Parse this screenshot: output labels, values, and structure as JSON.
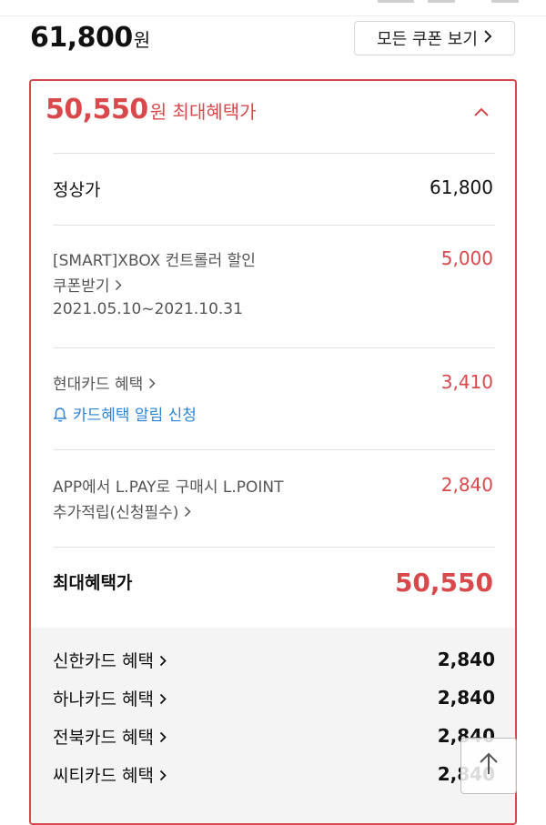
{
  "product": {
    "price": "61,800",
    "price_unit": "원",
    "all_coupons_label": "모든 쿠폰 보기"
  },
  "benefit": {
    "max_price": "50,550",
    "max_label": "원 최대혜택가",
    "regular_label": "정상가",
    "regular_value": "61,800",
    "coupon_title": "[SMART]XBOX 컨트롤러 할인",
    "coupon_link": "쿠폰받기",
    "coupon_period": "2021.05.10~2021.10.31",
    "coupon_value": "5,000",
    "card_label": "현대카드 혜택",
    "card_value": "3,410",
    "card_alert": "카드혜택 알림 신청",
    "lpay_line1": "APP에서 L.PAY로 구매시 L.POINT",
    "lpay_line2": "추가적립(신청필수)",
    "lpay_value": "2,840",
    "total_label": "최대혜택가",
    "total_value": "50,550"
  },
  "card_benefits": [
    {
      "label": "신한카드 혜택",
      "value": "2,840"
    },
    {
      "label": "하나카드 혜택",
      "value": "2,840"
    },
    {
      "label": "전북카드 혜택",
      "value": "2,840"
    },
    {
      "label": "씨티카드 혜택",
      "value": "2,840"
    }
  ],
  "colors": {
    "accent": "#d9494c",
    "link": "#2c84d8",
    "gray_bg": "#f4f4f4"
  },
  "icons": [
    "chevron-right-icon",
    "chevron-up-icon",
    "bell-icon",
    "arrow-up-icon"
  ]
}
